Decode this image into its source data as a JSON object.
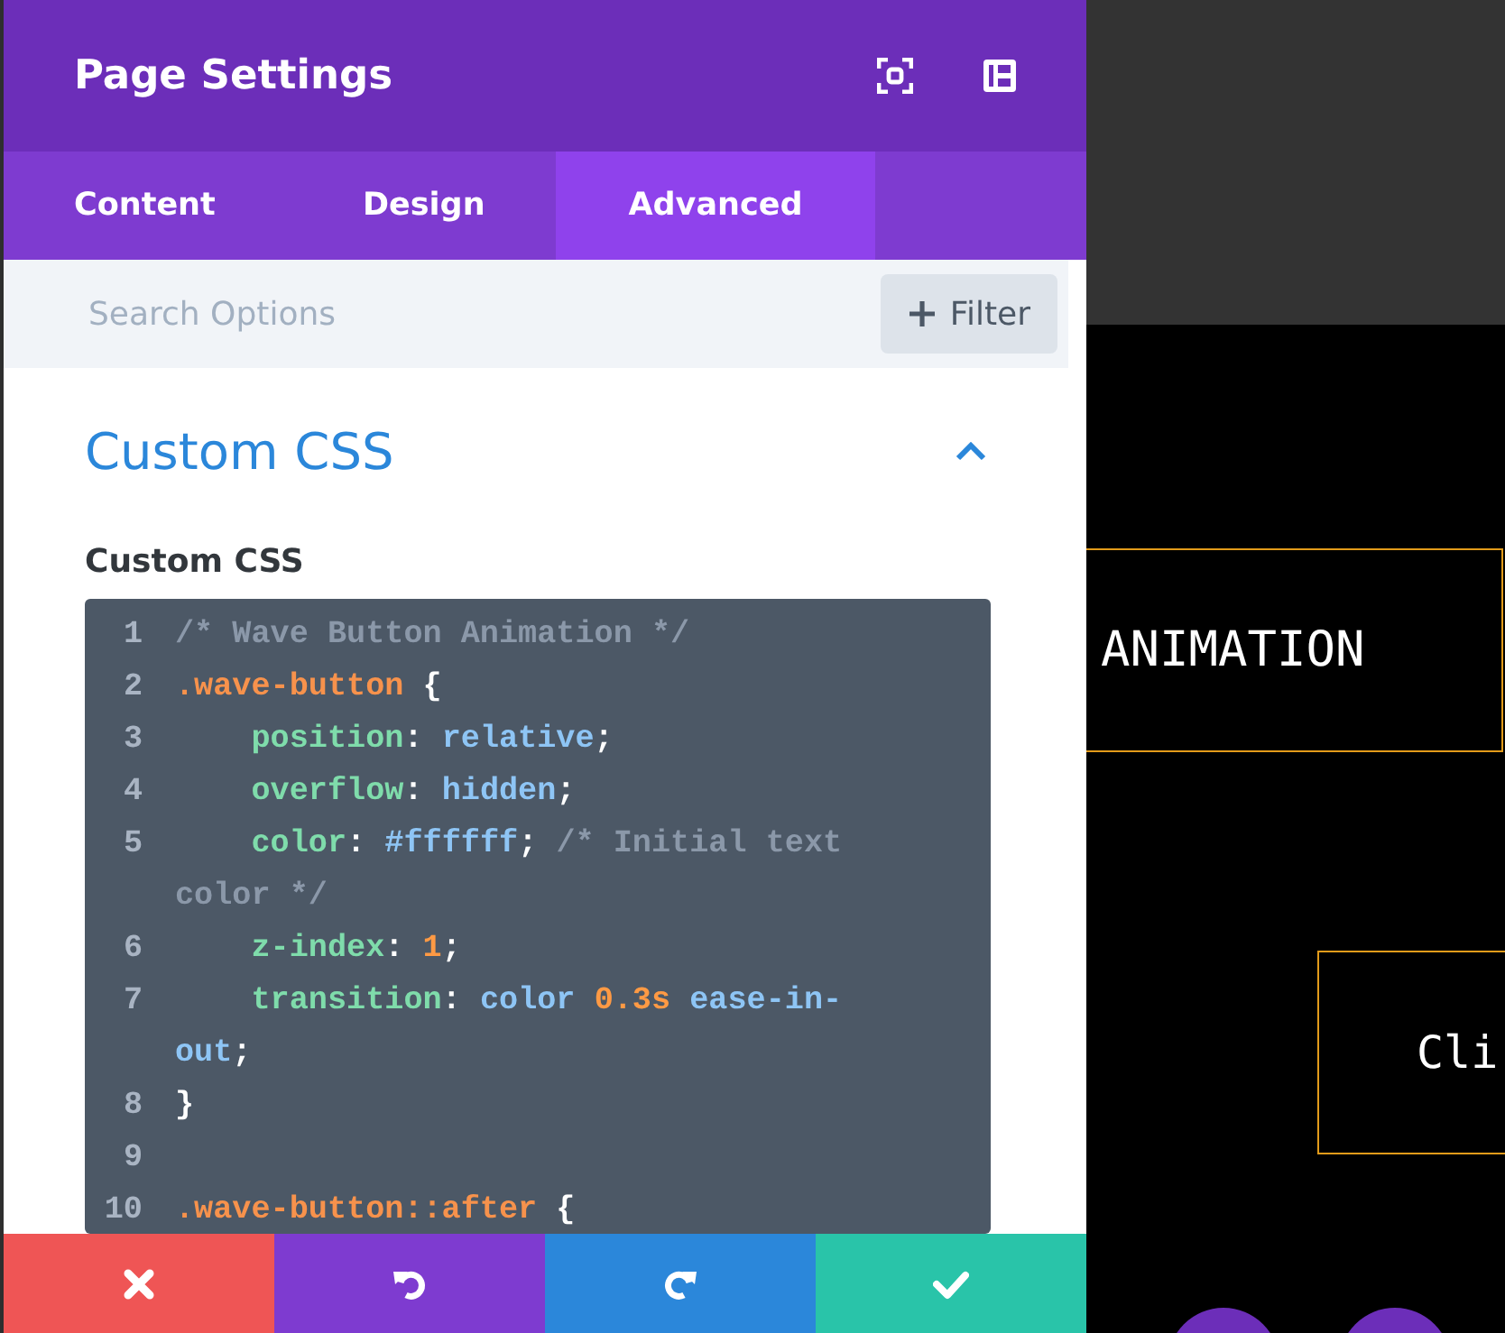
{
  "panel": {
    "title": "Page Settings",
    "tabs": [
      {
        "label": "Content",
        "selected": false
      },
      {
        "label": "Design",
        "selected": false
      },
      {
        "label": "Advanced",
        "selected": true
      }
    ],
    "search": {
      "placeholder": "Search Options",
      "filter_label": "Filter"
    },
    "section": {
      "title": "Custom CSS",
      "expanded": true,
      "field_label": "Custom CSS",
      "code_lines": [
        {
          "number": "1",
          "tokens": [
            {
              "kind": "comment",
              "text": "/* Wave Button Animation */"
            }
          ]
        },
        {
          "number": "2",
          "tokens": [
            {
              "kind": "selector",
              "text": ".wave-button"
            },
            {
              "kind": "punct",
              "text": " {"
            }
          ]
        },
        {
          "number": "3",
          "tokens": [
            {
              "kind": "property",
              "text": "    position"
            },
            {
              "kind": "punct",
              "text": ": "
            },
            {
              "kind": "value",
              "text": "relative"
            },
            {
              "kind": "punct",
              "text": ";"
            }
          ]
        },
        {
          "number": "4",
          "tokens": [
            {
              "kind": "property",
              "text": "    overflow"
            },
            {
              "kind": "punct",
              "text": ": "
            },
            {
              "kind": "value",
              "text": "hidden"
            },
            {
              "kind": "punct",
              "text": ";"
            }
          ]
        },
        {
          "number": "5",
          "tokens": [
            {
              "kind": "property",
              "text": "    color"
            },
            {
              "kind": "punct",
              "text": ": "
            },
            {
              "kind": "value",
              "text": "#ffffff"
            },
            {
              "kind": "punct",
              "text": "; "
            },
            {
              "kind": "comment",
              "text": "/* Initial text color */"
            }
          ]
        },
        {
          "number": "6",
          "tokens": [
            {
              "kind": "property",
              "text": "    z-index"
            },
            {
              "kind": "punct",
              "text": ": "
            },
            {
              "kind": "number",
              "text": "1"
            },
            {
              "kind": "punct",
              "text": ";"
            }
          ]
        },
        {
          "number": "7",
          "tokens": [
            {
              "kind": "property",
              "text": "    transition"
            },
            {
              "kind": "punct",
              "text": ": "
            },
            {
              "kind": "value",
              "text": "color "
            },
            {
              "kind": "number",
              "text": "0.3s"
            },
            {
              "kind": "value",
              "text": " ease-in-out"
            },
            {
              "kind": "punct",
              "text": ";"
            }
          ]
        },
        {
          "number": "8",
          "tokens": [
            {
              "kind": "punct",
              "text": "}"
            }
          ]
        },
        {
          "number": "9"
        },
        {
          "number": "10",
          "tokens": [
            {
              "kind": "selector",
              "text": ".wave-button::after"
            },
            {
              "kind": "punct",
              "text": " {"
            }
          ]
        }
      ]
    },
    "actions": [
      {
        "kind": "discard",
        "color": "#ef5555"
      },
      {
        "kind": "undo",
        "color": "#7e3bd0"
      },
      {
        "kind": "redo",
        "color": "#2b87da"
      },
      {
        "kind": "save",
        "color": "#29c4a9"
      }
    ]
  },
  "preview": {
    "buttons": [
      {
        "label": "ANIMATION"
      },
      {
        "label": "Cli"
      }
    ]
  }
}
